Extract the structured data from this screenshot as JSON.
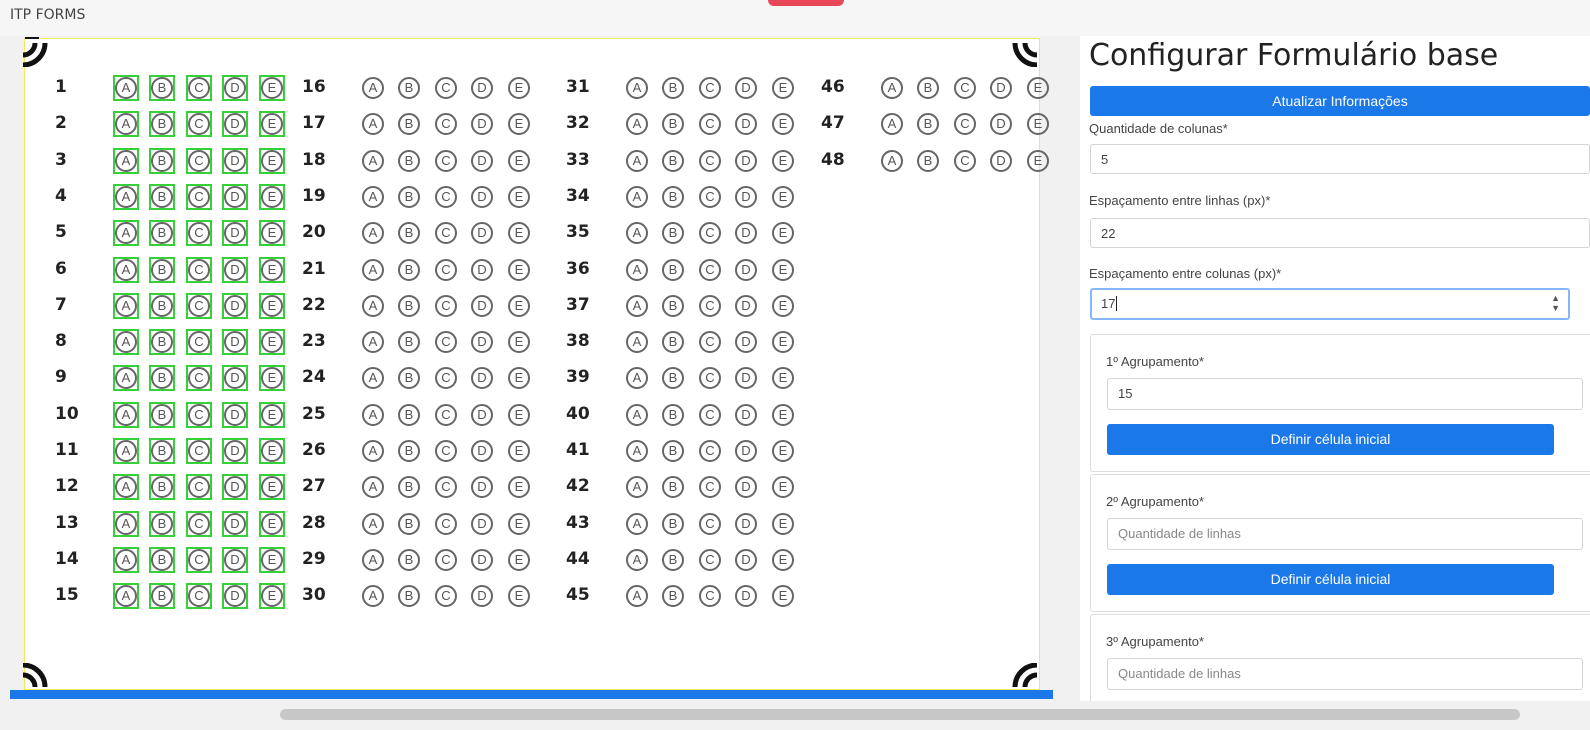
{
  "app": {
    "title": "ITP FORMS"
  },
  "sheet": {
    "row_count": 15,
    "columns": [
      {
        "start": 1,
        "end": 15,
        "highlighted": true
      },
      {
        "start": 16,
        "end": 30,
        "highlighted": false
      },
      {
        "start": 31,
        "end": 45,
        "highlighted": false
      },
      {
        "start": 46,
        "end": 48,
        "highlighted": false
      }
    ],
    "options": [
      "A",
      "B",
      "C",
      "D",
      "E"
    ],
    "highlight_color": "#36d13a"
  },
  "panel": {
    "title": "Configurar Formulário base",
    "update_button": "Atualizar Informações",
    "columns_label": "Quantidade de colunas*",
    "columns_value": "5",
    "row_spacing_label": "Espaçamento entre linhas (px)*",
    "row_spacing_value": "22",
    "col_spacing_label": "Espaçamento entre colunas (px)*",
    "col_spacing_value": "17",
    "groups": [
      {
        "label": "1º Agrupamento*",
        "value": "15",
        "placeholder": "Quantidade de linhas",
        "button": "Definir célula inicial"
      },
      {
        "label": "2º Agrupamento*",
        "value": "",
        "placeholder": "Quantidade de linhas",
        "button": "Definir célula inicial"
      },
      {
        "label": "3º Agrupamento*",
        "value": "",
        "placeholder": "Quantidade de linhas"
      }
    ]
  },
  "colors": {
    "primary": "#1b78e8",
    "accent_tab": "#e8475a",
    "sheet_border": "#f2e85a"
  }
}
